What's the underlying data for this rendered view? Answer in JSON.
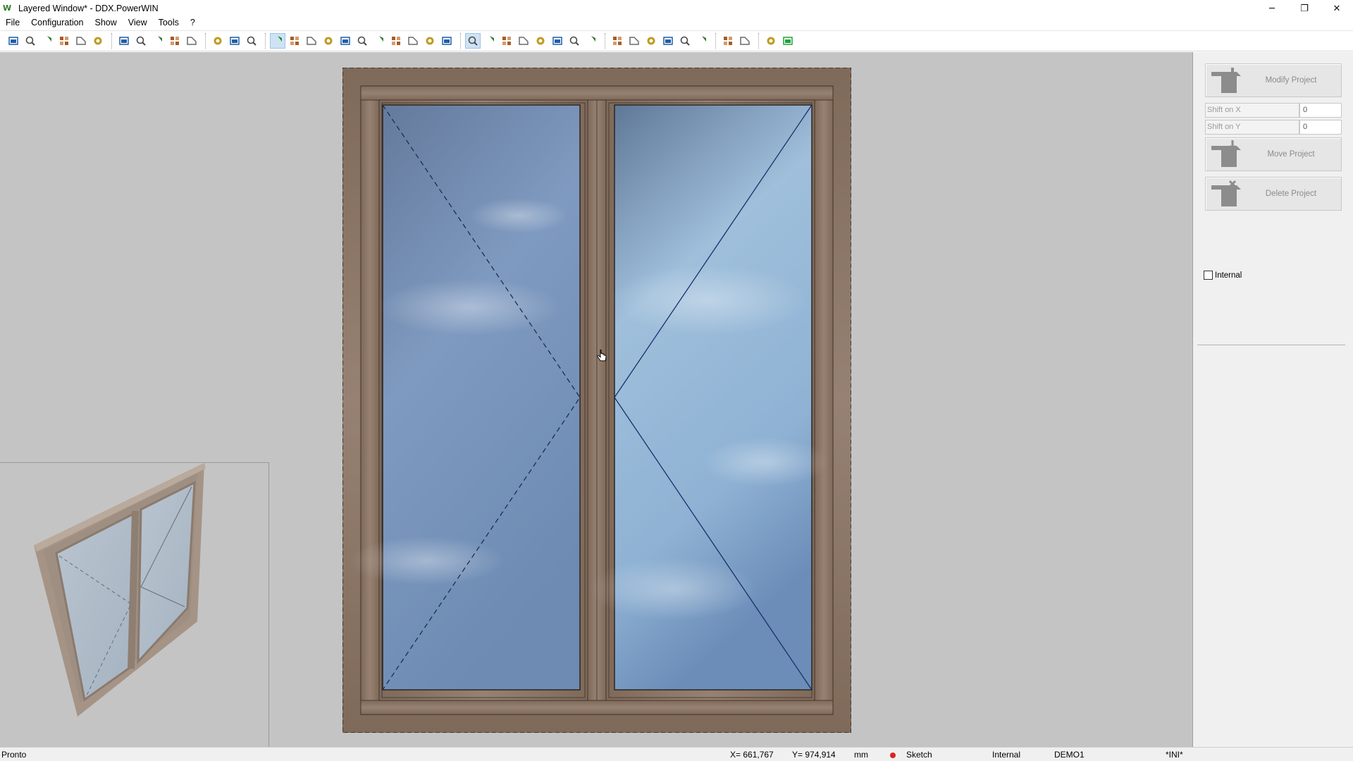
{
  "window": {
    "title": "Layered Window* - DDX.PowerWIN",
    "app_icon": "W",
    "controls": {
      "minimize": "─",
      "maximize": "❐",
      "close": "✕"
    }
  },
  "menu": [
    "File",
    "Configuration",
    "Show",
    "View",
    "Tools",
    "?"
  ],
  "colors": {
    "frame_wood": "#8e7968",
    "glass_dark": "#6a84a8",
    "glass_light": "#a8c4de",
    "canvas_bg": "#c4c4c4",
    "status_dot": "#e02020",
    "toolbar_active": "#cfe3f5"
  },
  "toolbar": {
    "groups": [
      [
        "new-icon",
        "open-template-icon",
        "open-icon",
        "save-icon",
        "email-icon",
        "export-icon"
      ],
      [
        "select-icon",
        "zoom-window-icon",
        "zoom-out-icon",
        "zoom-in-icon",
        "pan-hand-icon"
      ],
      [
        "select-element-icon",
        "frame-icon",
        "measure-icon"
      ],
      [
        "view-shield-green-icon",
        "view-shield-outline-icon",
        "view-shield-box-icon",
        "drop-icon",
        "grid-icon",
        "bars-icon",
        "sash-icon",
        "cut-icon",
        "profile-icon",
        "frame-sizing-icon",
        "layout-icon"
      ],
      [
        "internal-view-icon",
        "align-left-icon",
        "align-center-icon",
        "align-right-icon",
        "align-top-icon",
        "align-middle-icon",
        "align-bottom-icon",
        "fill-icon"
      ],
      [
        "corner-icon",
        "corner-alt-icon",
        "split-icon",
        "stack-icon",
        "key-icon",
        "panel-icon"
      ],
      [
        "arc-icon",
        "arc-alt-icon"
      ],
      [
        "user-icon",
        "message-icon"
      ]
    ],
    "active": [
      "view-shield-green-icon",
      "internal-view-icon"
    ]
  },
  "right_panel": {
    "modify_label": "Modify Project",
    "shift_x_label": "Shift on X",
    "shift_x_value": "0",
    "shift_y_label": "Shift on Y",
    "shift_y_value": "0",
    "move_label": "Move Project",
    "delete_label": "Delete Project",
    "internal_label": "Internal",
    "internal_checked": false
  },
  "status": {
    "ready": "Pronto",
    "x": "X= 661,767",
    "y": "Y= 974,914",
    "unit": "mm",
    "mode": "Sketch",
    "view": "Internal",
    "user": "DEMO1",
    "ini": "*INI*"
  }
}
